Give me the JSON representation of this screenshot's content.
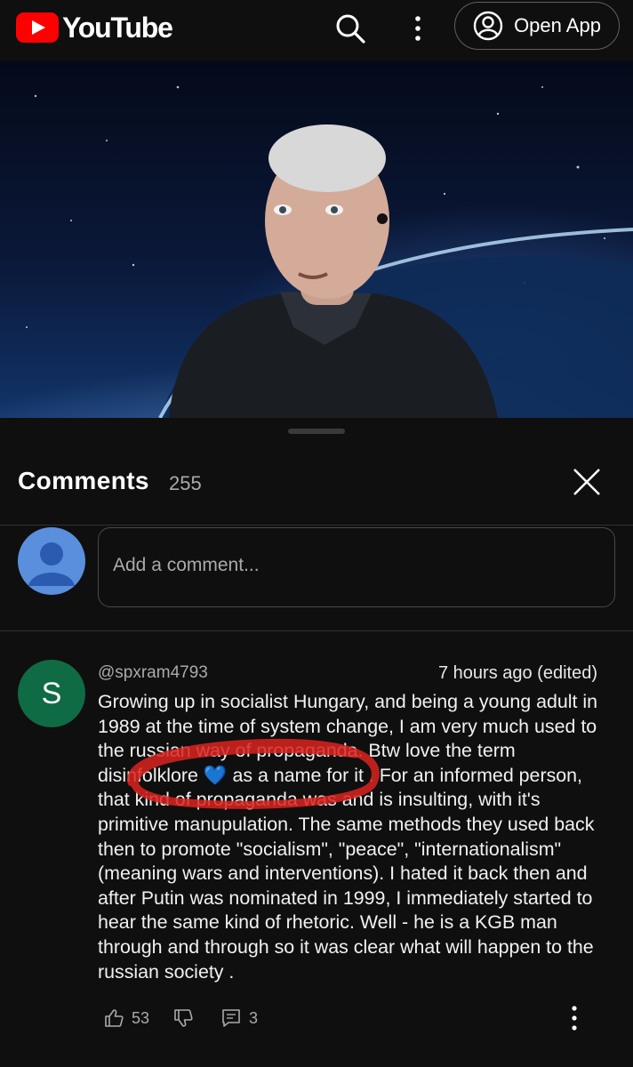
{
  "header": {
    "logo_text": "YouTube",
    "search_icon": "search-icon",
    "more_icon": "kebab-menu-icon",
    "open_app_label": "Open App",
    "colors": {
      "logo_red": "#ff0000",
      "background": "#0f0f0f"
    }
  },
  "video": {
    "description_icon": "video-player"
  },
  "comments": {
    "title": "Comments",
    "count": "255",
    "add_placeholder": "Add a comment...",
    "items": [
      {
        "avatar_letter": "S",
        "avatar_color": "#0f6b43",
        "author": "@spxram4793",
        "time": "7 hours ago (edited)",
        "text": "Growing up in socialist Hungary, and being a young adult in 1989 at the time of system change, I am very much used to the russian way of propaganda. Btw love the term disinfolklore 💙 as a name for it . For an informed person, that kind of propaganda was and is insulting, with it's primitive manupulation. The same methods they used back then to promote \"socialism\", \"peace\", \"internationalism\" (meaning wars and interventions). I hated it back then and after Putin was nominated in 1999, I immediately started to hear the same kind of rhetoric. Well - he is a KGB man through and through so it was clear what will happen to the russian society .",
        "likes": "53",
        "replies": "3"
      }
    ]
  }
}
